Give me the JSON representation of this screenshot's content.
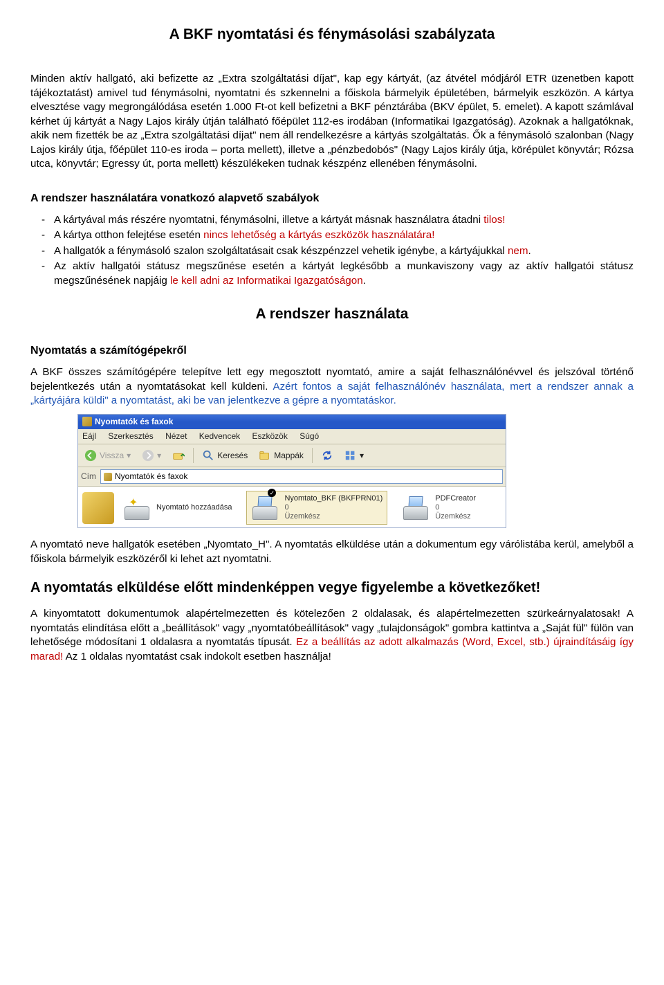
{
  "title": "A BKF nyomtatási és fénymásolási szabályzata",
  "intro_p": "Minden aktív hallgató, aki befizette az „Extra szolgáltatási díjat\", kap egy kártyát, (az átvétel módjáról ETR üzenetben kapott tájékoztatást) amivel tud fénymásolni, nyomtatni és szkennelni a főiskola bármelyik épületében, bármelyik eszközön. A kártya elvesztése vagy megrongálódása esetén 1.000 Ft-ot kell befizetni a BKF pénztárába (BKV épület, 5. emelet). A kapott számlával kérhet új kártyát a Nagy Lajos király útján található főépület 112-es irodában (Informatikai Igazgatóság). Azoknak a hallgatóknak, akik nem fizették be az „Extra szolgáltatási díjat\" nem áll rendelkezésre a kártyás szolgáltatás. Ők a fénymásoló szalonban (Nagy Lajos király útja, főépület 110-es iroda – porta mellett), illetve a „pénzbedobós\" (Nagy Lajos király útja, körépület könyvtár; Rózsa utca, könyvtár; Egressy út, porta mellett) készülékeken tudnak készpénz ellenében fénymásolni.",
  "rules_heading": "A rendszer használatára vonatkozó alapvető szabályok",
  "rules": [
    {
      "pre": "A kártyával más részére nyomtatni, fénymásolni, illetve a kártyát másnak használatra átadni ",
      "red": "tilos!"
    },
    {
      "pre": "A kártya otthon felejtése esetén ",
      "red": "nincs lehetőség a kártyás eszközök használatára!"
    },
    {
      "pre": "A hallgatók a fénymásoló szalon szolgáltatásait csak készpénzzel vehetik igénybe, a kártyájukkal ",
      "red": "nem",
      "post": "."
    },
    {
      "pre": "Az aktív hallgatói státusz megszűnése esetén a kártyát legkésőbb a munkaviszony vagy az aktív hallgatói státusz megszűnésének napjáig ",
      "red": "le kell adni az Informatikai Igazgatóságon",
      "post": "."
    }
  ],
  "use_heading": "A rendszer használata",
  "print_heading": "Nyomtatás a számítógépekről",
  "print_p_a": "A BKF összes számítógépére telepítve lett egy megosztott nyomtató, amire a saját felhasználónévvel és jelszóval történő bejelentkezés után a nyomtatásokat kell küldeni. ",
  "print_p_blue": "Azért fontos a saját felhasználónév használata, mert a rendszer annak a „kártyájára küldi\" a nyomtatást, aki be van jelentkezve a gépre a nyomtatáskor.",
  "xp": {
    "title": "Nyomtatók és faxok",
    "menu": {
      "fajl": "Eájl",
      "szerk": "Szerkesztés",
      "nezet": "Nézet",
      "kedv": "Kedvencek",
      "eszk": "Eszközök",
      "sugo": "Súgó"
    },
    "toolbar": {
      "vissza": "Vissza",
      "kereses": "Keresés",
      "mappak": "Mappák"
    },
    "cim_label": "Cím",
    "cim_value": "Nyomtatók és faxok",
    "task_label": "Nyomtató hozzáadása",
    "printers": [
      {
        "name": "Nyomtato_BKF (BKFPRN01)",
        "queue": "0",
        "state": "Üzemkész",
        "selected": true
      },
      {
        "name": "PDFCreator",
        "queue": "0",
        "state": "Üzemkész",
        "selected": false
      }
    ]
  },
  "after_img_p": "A nyomtató neve hallgatók esetében „Nyomtato_H\". A nyomtatás elküldése után a dokumentum egy várólistába kerül, amelyből a főiskola bármelyik eszközéről ki lehet azt nyomtatni.",
  "big_notice": "A nyomtatás elküldése előtt mindenképpen vegye figyelembe a következőket!",
  "last_p_a": "A kinyomtatott dokumentumok alapértelmezetten és kötelezően 2 oldalasak, és alapértelmezetten szürkeárnyalatosak! A nyomtatás elindítása előtt a „beállítások\" vagy „nyomtatóbeállítások\" vagy „tulajdonságok\" gombra kattintva a „Saját fül\" fülön van lehetősége módosítani 1 oldalasra a nyomtatás típusát. ",
  "last_p_red": "Ez a beállítás az adott alkalmazás (Word, Excel, stb.) újraindításáig így marad!",
  "last_p_b": " Az 1 oldalas nyomtatást csak indokolt esetben használja!"
}
